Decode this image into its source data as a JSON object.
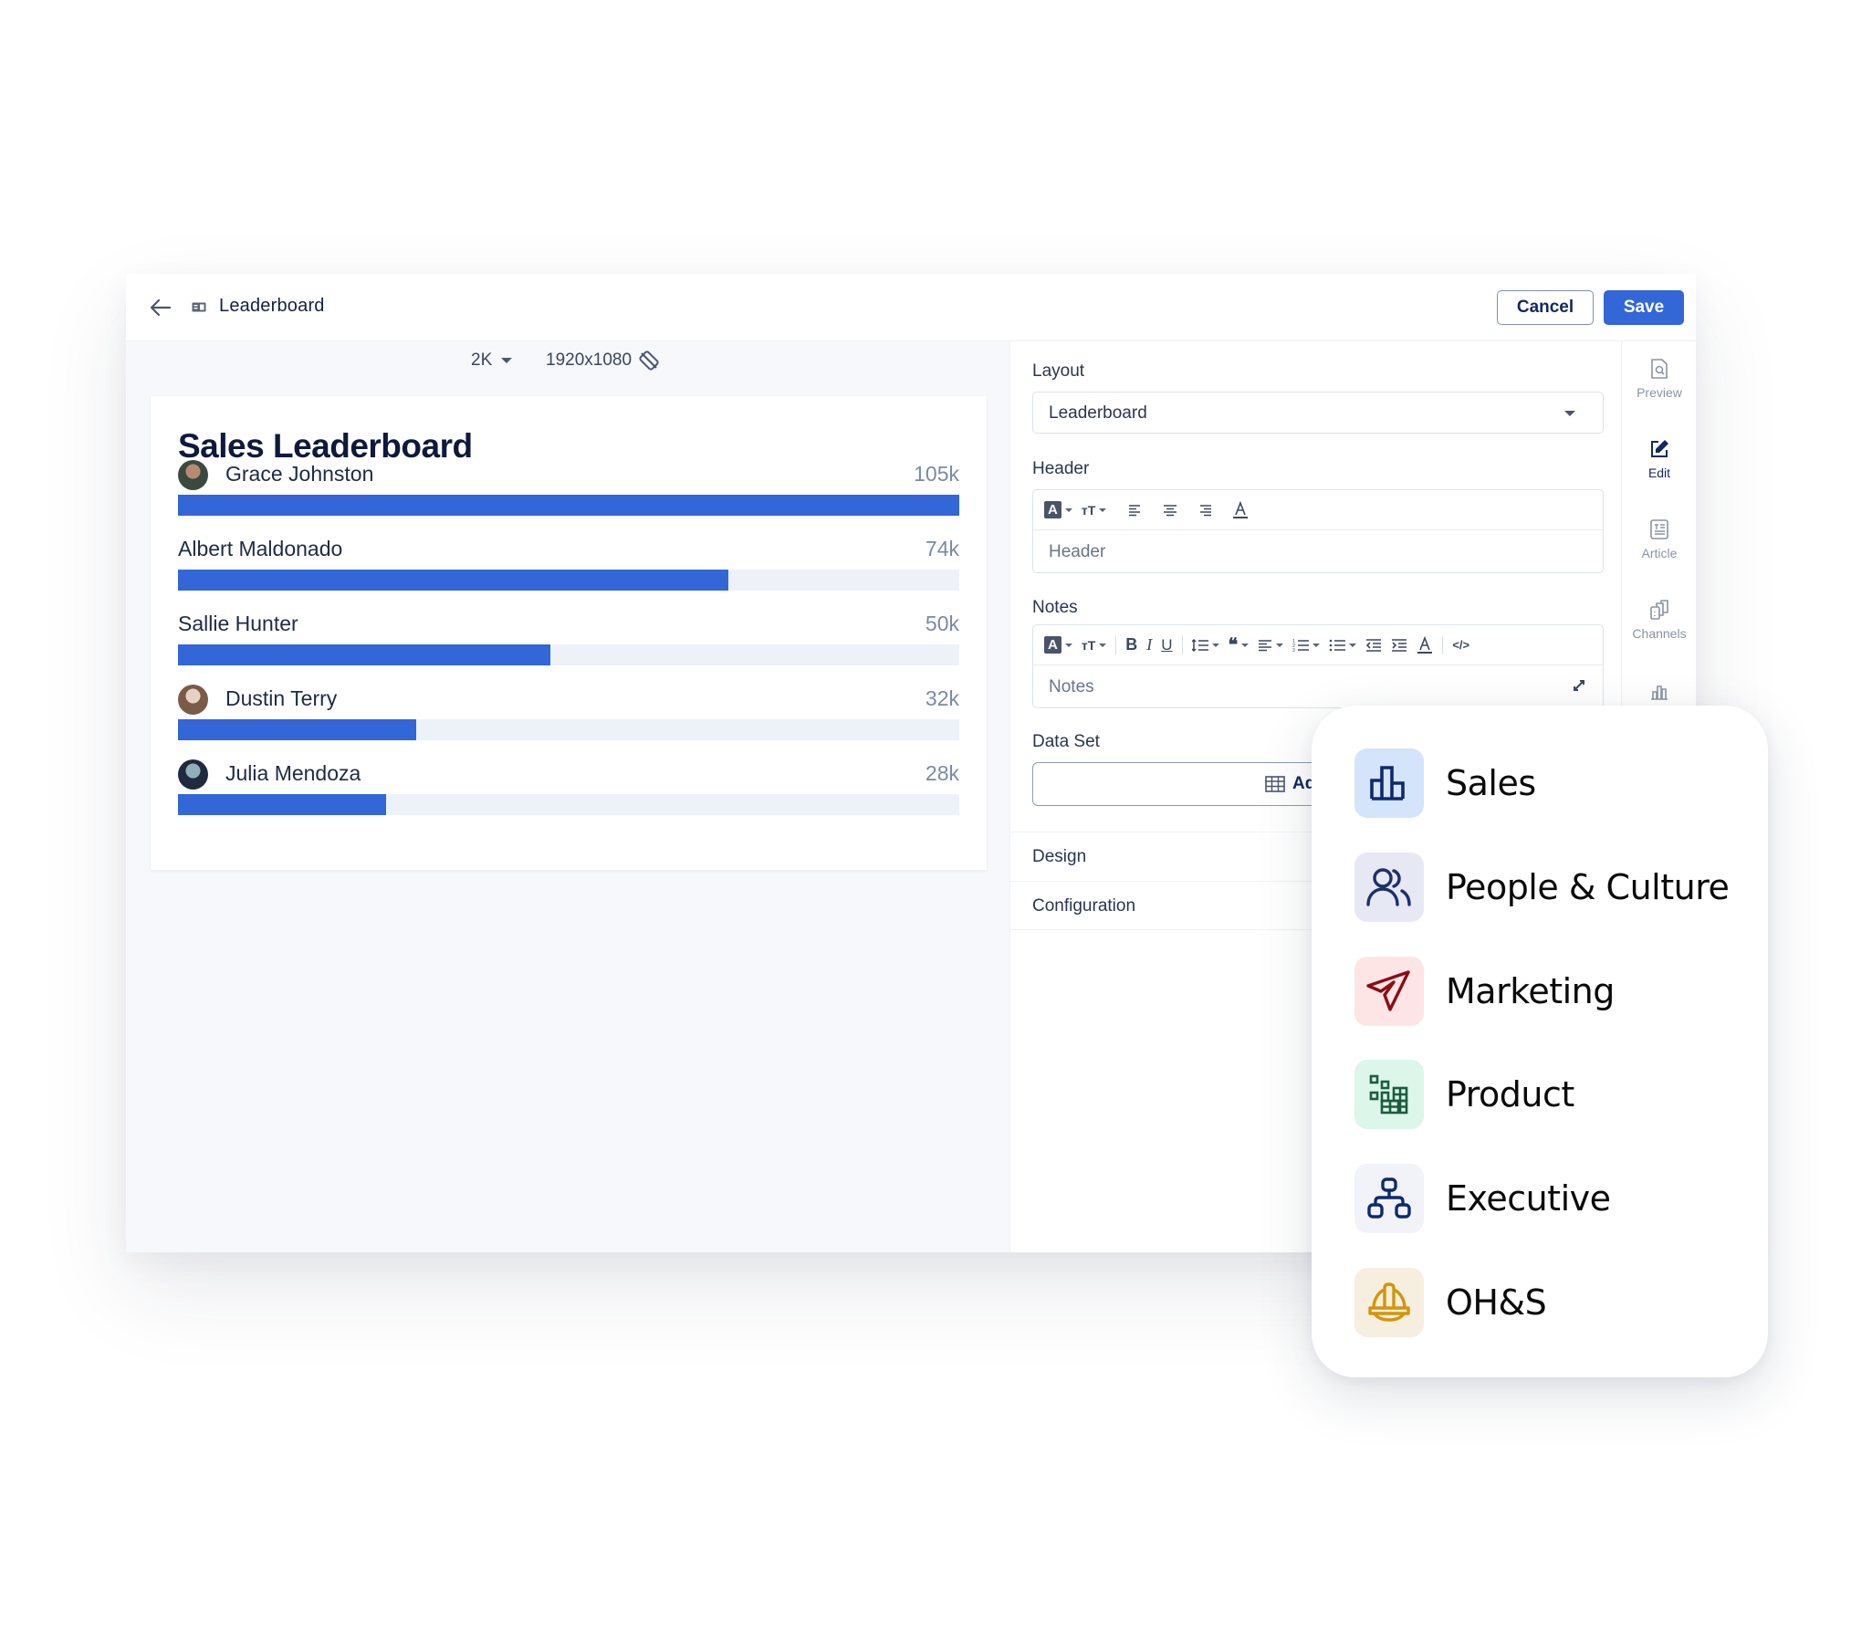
{
  "topbar": {
    "title": "Leaderboard",
    "back_icon": "arrow-left-icon",
    "layout_icon": "layout-icon",
    "cancel_label": "Cancel",
    "save_label": "Save"
  },
  "canvas": {
    "resolution_option": "2K",
    "resolution_value": "1920x1080",
    "rotate_icon": "rotate-screen-icon"
  },
  "leaderboard": {
    "title": "Sales Leaderboard",
    "bar_color": "#3366d6",
    "track_color": "#edf2f9",
    "max_value_k": 105,
    "rows": [
      {
        "name": "Grace Johnston",
        "value_label": "105k",
        "value_k": 105,
        "has_avatar": true
      },
      {
        "name": "Albert Maldonado",
        "value_label": "74k",
        "value_k": 74,
        "has_avatar": false
      },
      {
        "name": "Sallie Hunter",
        "value_label": "50k",
        "value_k": 50,
        "has_avatar": false
      },
      {
        "name": "Dustin Terry",
        "value_label": "32k",
        "value_k": 32,
        "has_avatar": true
      },
      {
        "name": "Julia Mendoza",
        "value_label": "28k",
        "value_k": 28,
        "has_avatar": true
      }
    ]
  },
  "editor": {
    "layout_label": "Layout",
    "layout_value": "Leaderboard",
    "header_label": "Header",
    "header_placeholder": "Header",
    "notes_label": "Notes",
    "notes_placeholder": "Notes",
    "dataset_label": "Data Set",
    "dataset_button": "Ad",
    "sections": [
      "Design",
      "Configuration"
    ]
  },
  "rail": {
    "items": [
      {
        "label": "Preview",
        "icon": "preview-icon",
        "active": false
      },
      {
        "label": "Edit",
        "icon": "edit-icon",
        "active": true
      },
      {
        "label": "Article",
        "icon": "article-icon",
        "active": false
      },
      {
        "label": "Channels",
        "icon": "channels-icon",
        "active": false
      },
      {
        "label": "",
        "icon": "chart-icon",
        "active": false
      }
    ]
  },
  "categories": [
    {
      "label": "Sales",
      "icon": "bar-chart-icon",
      "bg": "#d3e4fb",
      "fg": "#0f2a6b"
    },
    {
      "label": "People & Culture",
      "icon": "people-icon",
      "bg": "#e6e8f4",
      "fg": "#1e2f6e"
    },
    {
      "label": "Marketing",
      "icon": "send-icon",
      "bg": "#fde5e6",
      "fg": "#8a0d14"
    },
    {
      "label": "Product",
      "icon": "blocks-icon",
      "bg": "#dcf6ea",
      "fg": "#1c5c3c"
    },
    {
      "label": "Executive",
      "icon": "org-chart-icon",
      "bg": "#f1f3f9",
      "fg": "#0f2a6b"
    },
    {
      "label": "OH&S",
      "icon": "hard-hat-icon",
      "bg": "#f6efe0",
      "fg": "#d2960c"
    }
  ]
}
